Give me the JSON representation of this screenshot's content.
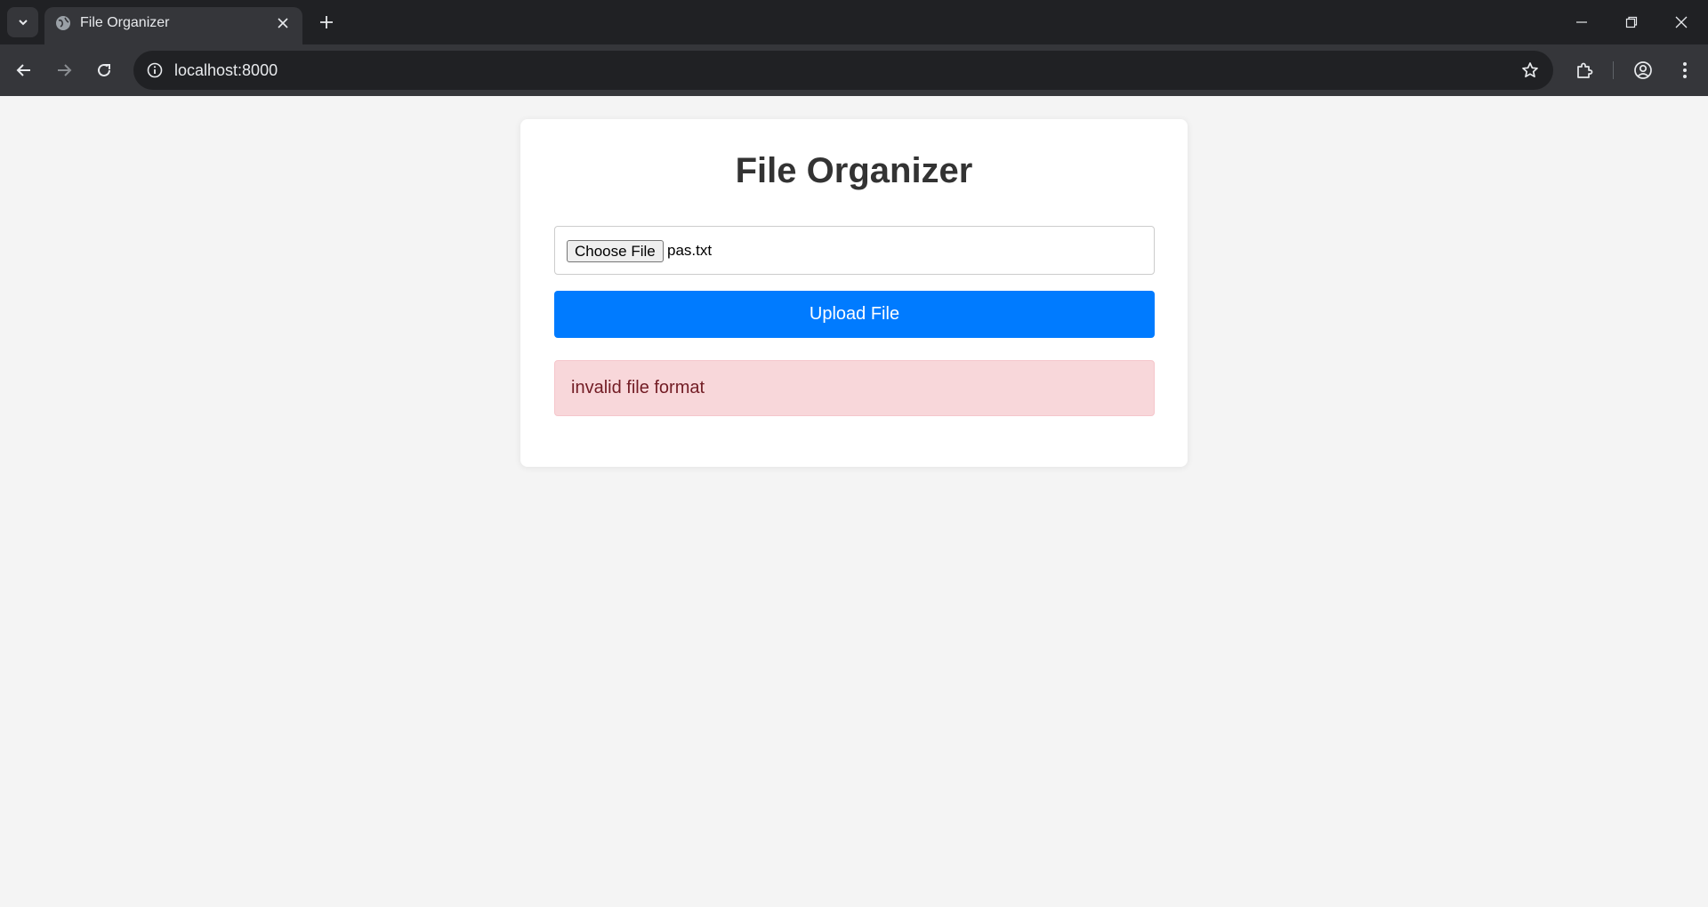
{
  "browser": {
    "tab": {
      "title": "File Organizer",
      "favicon": "globe-icon"
    },
    "address_bar": {
      "url": "localhost:8000"
    },
    "colors": {
      "chrome_dark": "#202124",
      "chrome_tab": "#35363a",
      "chrome_text": "#e8eaed"
    }
  },
  "page": {
    "title": "File Organizer",
    "file_input": {
      "button_label": "Choose File",
      "selected_file": "pas.txt"
    },
    "upload_button": {
      "label": "Upload File"
    },
    "alert": {
      "message": "invalid file format",
      "type": "error"
    },
    "colors": {
      "primary": "#007bff",
      "alert_bg": "#f8d7da",
      "alert_text": "#721c24",
      "page_bg": "#f4f4f4"
    }
  }
}
